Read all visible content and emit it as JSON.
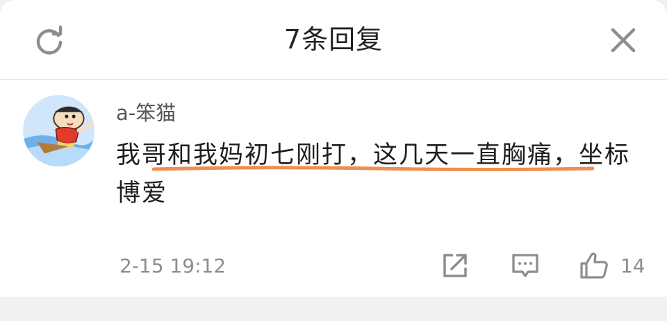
{
  "header": {
    "title": "7条回复",
    "refresh_icon": "refresh-icon",
    "close_icon": "close-icon"
  },
  "reply": {
    "avatar_icon": "avatar-crayon-shin-chan",
    "username": "a-笨猫",
    "content": "我哥和我妈初七刚打，这几天一直胸痛，坐标博爱",
    "timestamp": "2-15 19:12",
    "actions": {
      "share_icon": "share-icon",
      "comment_icon": "comment-icon",
      "like_icon": "thumbs-up-icon",
      "like_count": "14"
    }
  },
  "colors": {
    "underline": "#ee8f4f",
    "icon_gray": "#8d8d8d",
    "text_dark": "#1e1e1e"
  }
}
